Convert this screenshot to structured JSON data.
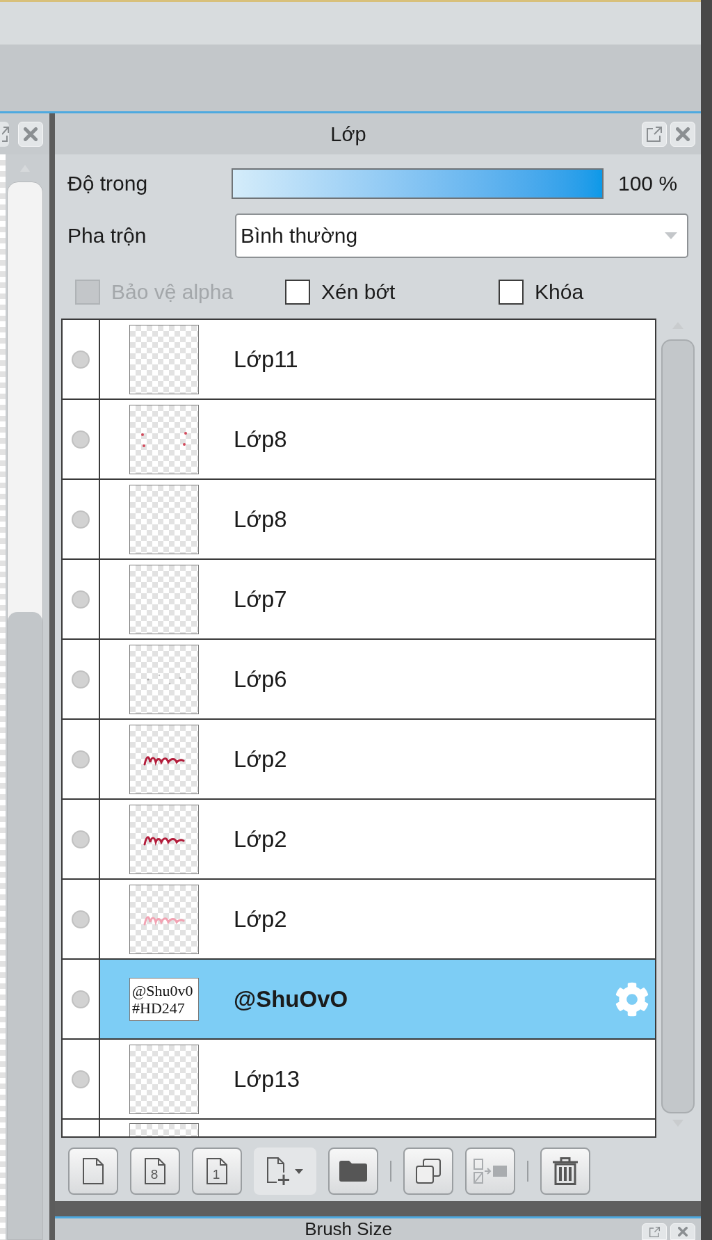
{
  "panel": {
    "title": "Lớp"
  },
  "opacity": {
    "label": "Độ trong",
    "level": 1,
    "reading": "100 %"
  },
  "blend_mode": {
    "label": "Pha trộn",
    "value": "Bình thường"
  },
  "options": [
    {
      "label": "Bảo vệ alpha",
      "checked": false,
      "disabled": true
    },
    {
      "label": "Xén bớt",
      "checked": false,
      "disabled": false
    },
    {
      "label": "Khóa",
      "checked": false,
      "disabled": false
    }
  ],
  "layers": [
    {
      "name": "Lớp11",
      "thumbnail": {
        "kind": "blank"
      },
      "selected": false
    },
    {
      "name": "Lớp8",
      "thumbnail": {
        "kind": "dots"
      },
      "selected": false
    },
    {
      "name": "Lớp8",
      "thumbnail": {
        "kind": "blank"
      },
      "selected": false
    },
    {
      "name": "Lớp7",
      "thumbnail": {
        "kind": "blank"
      },
      "selected": false
    },
    {
      "name": "Lớp6",
      "thumbnail": {
        "kind": "specks"
      },
      "selected": false
    },
    {
      "name": "Lớp2",
      "thumbnail": {
        "kind": "script"
      },
      "selected": false
    },
    {
      "name": "Lớp2",
      "thumbnail": {
        "kind": "script"
      },
      "selected": false
    },
    {
      "name": "Lớp2",
      "thumbnail": {
        "kind": "script-faint"
      },
      "selected": false
    },
    {
      "name": "@ShuOvO",
      "thumbnail": {
        "kind": "text",
        "lines": [
          "@Shu0v0",
          "#HD247"
        ]
      },
      "selected": true
    },
    {
      "name": "Lớp13",
      "thumbnail": {
        "kind": "blank"
      },
      "selected": false
    }
  ],
  "partial_layer": {
    "thumbnail": {
      "kind": "blank"
    }
  },
  "toolbar": [
    {
      "kind": "page",
      "disabled": false
    },
    {
      "kind": "page",
      "glyph": "8",
      "disabled": false
    },
    {
      "kind": "page",
      "glyph": "1",
      "disabled": false
    },
    {
      "kind": "add-menu",
      "disabled": false
    },
    {
      "kind": "folder",
      "disabled": false
    },
    {
      "kind": "separator"
    },
    {
      "kind": "duplicate",
      "disabled": false
    },
    {
      "kind": "transfer",
      "disabled": true
    },
    {
      "kind": "separator"
    },
    {
      "kind": "trash",
      "disabled": false
    }
  ],
  "next_panel": {
    "title": "Brush Size"
  }
}
